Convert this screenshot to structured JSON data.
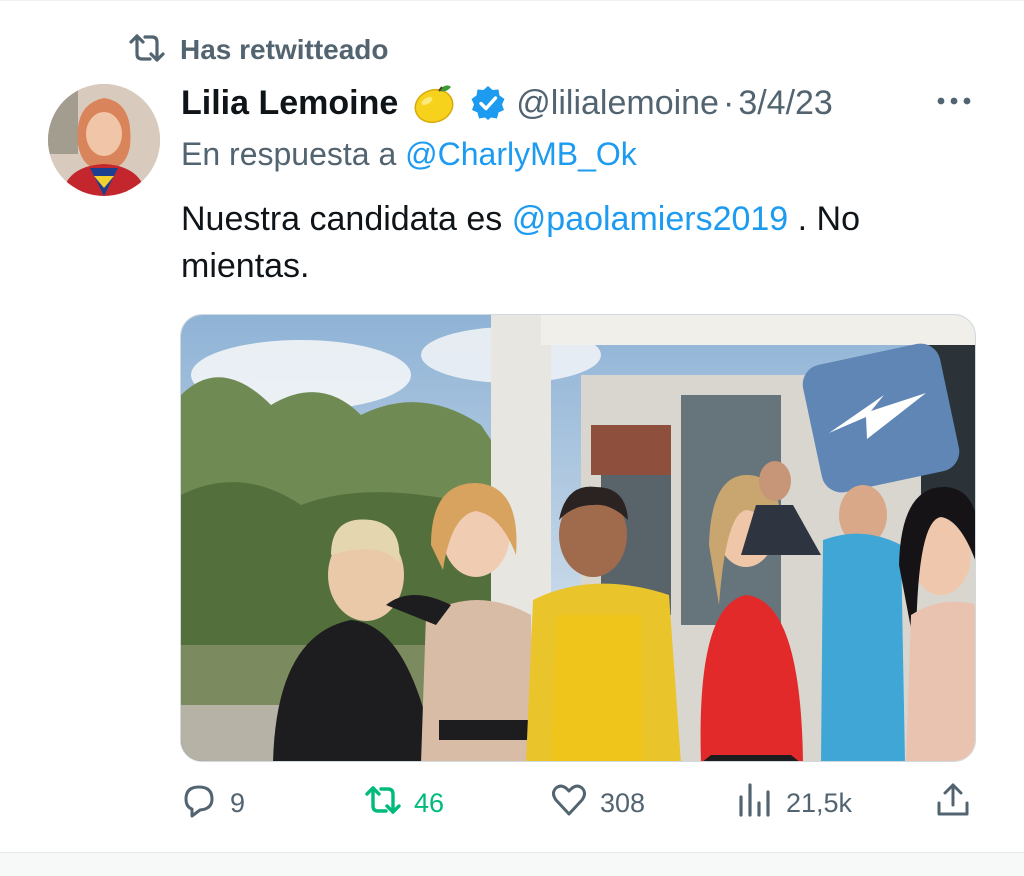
{
  "retweet_banner": {
    "icon": "retweet-icon",
    "label": "Has retwitteado"
  },
  "tweet": {
    "author": {
      "name": "Lilia Lemoine",
      "emoji": "lemon",
      "verified": true,
      "handle": "@lilialemoine",
      "avatar": "avatar-photo"
    },
    "separator": "·",
    "date": "3/4/23",
    "reply": {
      "prefix": "En respuesta a",
      "handle": "@CharlyMB_Ok"
    },
    "text": {
      "before": "Nuestra candidata es ",
      "mention": "@paolamiers2019",
      "after": " . No mientas."
    },
    "media": {
      "type": "photo",
      "overlay_icon": "arrow-sticker-icon"
    }
  },
  "actions": {
    "replies": "9",
    "retweets": "46",
    "likes": "308",
    "views": "21,5k"
  },
  "colors": {
    "link": "#1d9bf0",
    "secondary_text": "#536471",
    "retweet_active": "#00ba7c",
    "verified": "#1d9bf0"
  }
}
